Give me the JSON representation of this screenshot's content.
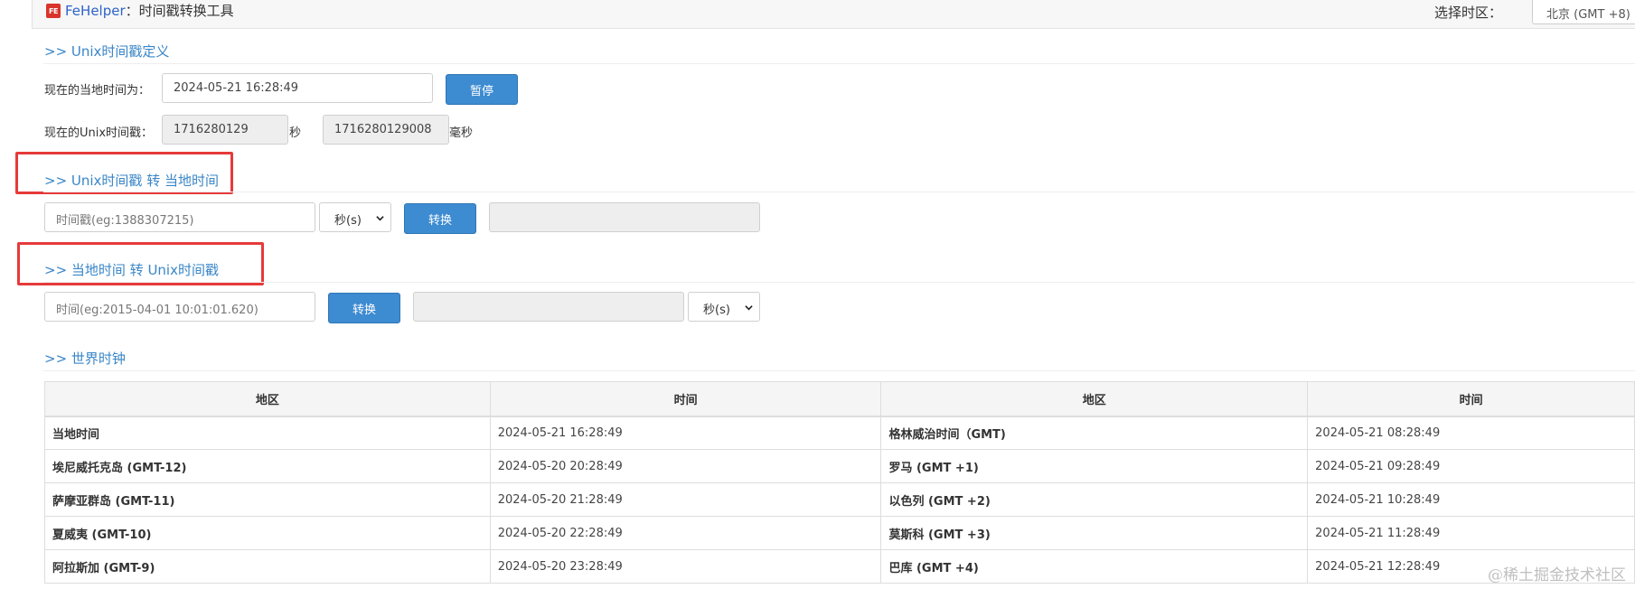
{
  "header": {
    "brand": "FeHelper",
    "separator": "：",
    "tool_title": "时间戳转换工具",
    "timezone_label": "选择时区：",
    "timezone_value": "北京 (GMT +8)"
  },
  "unix_definition": {
    "title": ">> Unix时间戳定义",
    "local_time_label": "现在的当地时间为：",
    "local_time_value": "2024-05-21 16:28:49",
    "pause_button": "暂停",
    "unix_label": "现在的Unix时间戳：",
    "unix_seconds": "1716280129",
    "seconds_unit": "秒",
    "unix_millis": "1716280129008",
    "millis_unit": "毫秒"
  },
  "unix_to_local": {
    "title": ">> Unix时间戳 转 当地时间",
    "input_placeholder": "时间戳(eg:1388307215)",
    "unit_select": "秒(s)",
    "convert_button": "转换",
    "result": ""
  },
  "local_to_unix": {
    "title": ">> 当地时间 转 Unix时间戳",
    "input_placeholder": "时间(eg:2015-04-01 10:01:01.620)",
    "convert_button": "转换",
    "result": "",
    "unit_select": "秒(s)"
  },
  "world_clock": {
    "title": ">> 世界时钟",
    "headers": [
      "地区",
      "时间",
      "地区",
      "时间"
    ],
    "rows": [
      [
        "当地时间",
        "2024-05-21 16:28:49",
        "格林威治时间（GMT)",
        "2024-05-21 08:28:49"
      ],
      [
        "埃尼威托克岛 (GMT-12)",
        "2024-05-20 20:28:49",
        "罗马 (GMT +1)",
        "2024-05-21 09:28:49"
      ],
      [
        "萨摩亚群岛 (GMT-11)",
        "2024-05-20 21:28:49",
        "以色列 (GMT +2)",
        "2024-05-21 10:28:49"
      ],
      [
        "夏威夷 (GMT-10)",
        "2024-05-20 22:28:49",
        "莫斯科 (GMT +3)",
        "2024-05-21 11:28:49"
      ],
      [
        "阿拉斯加 (GMT-9)",
        "2024-05-20 23:28:49",
        "巴库 (GMT +4)",
        "2024-05-21 12:28:49"
      ]
    ]
  },
  "watermark": "@稀土掘金技术社区",
  "colors": {
    "accent": "#3a86c8",
    "button": "#3d8bd1",
    "highlight_box": "#e63a3a",
    "brand_text": "#2e63c9"
  }
}
